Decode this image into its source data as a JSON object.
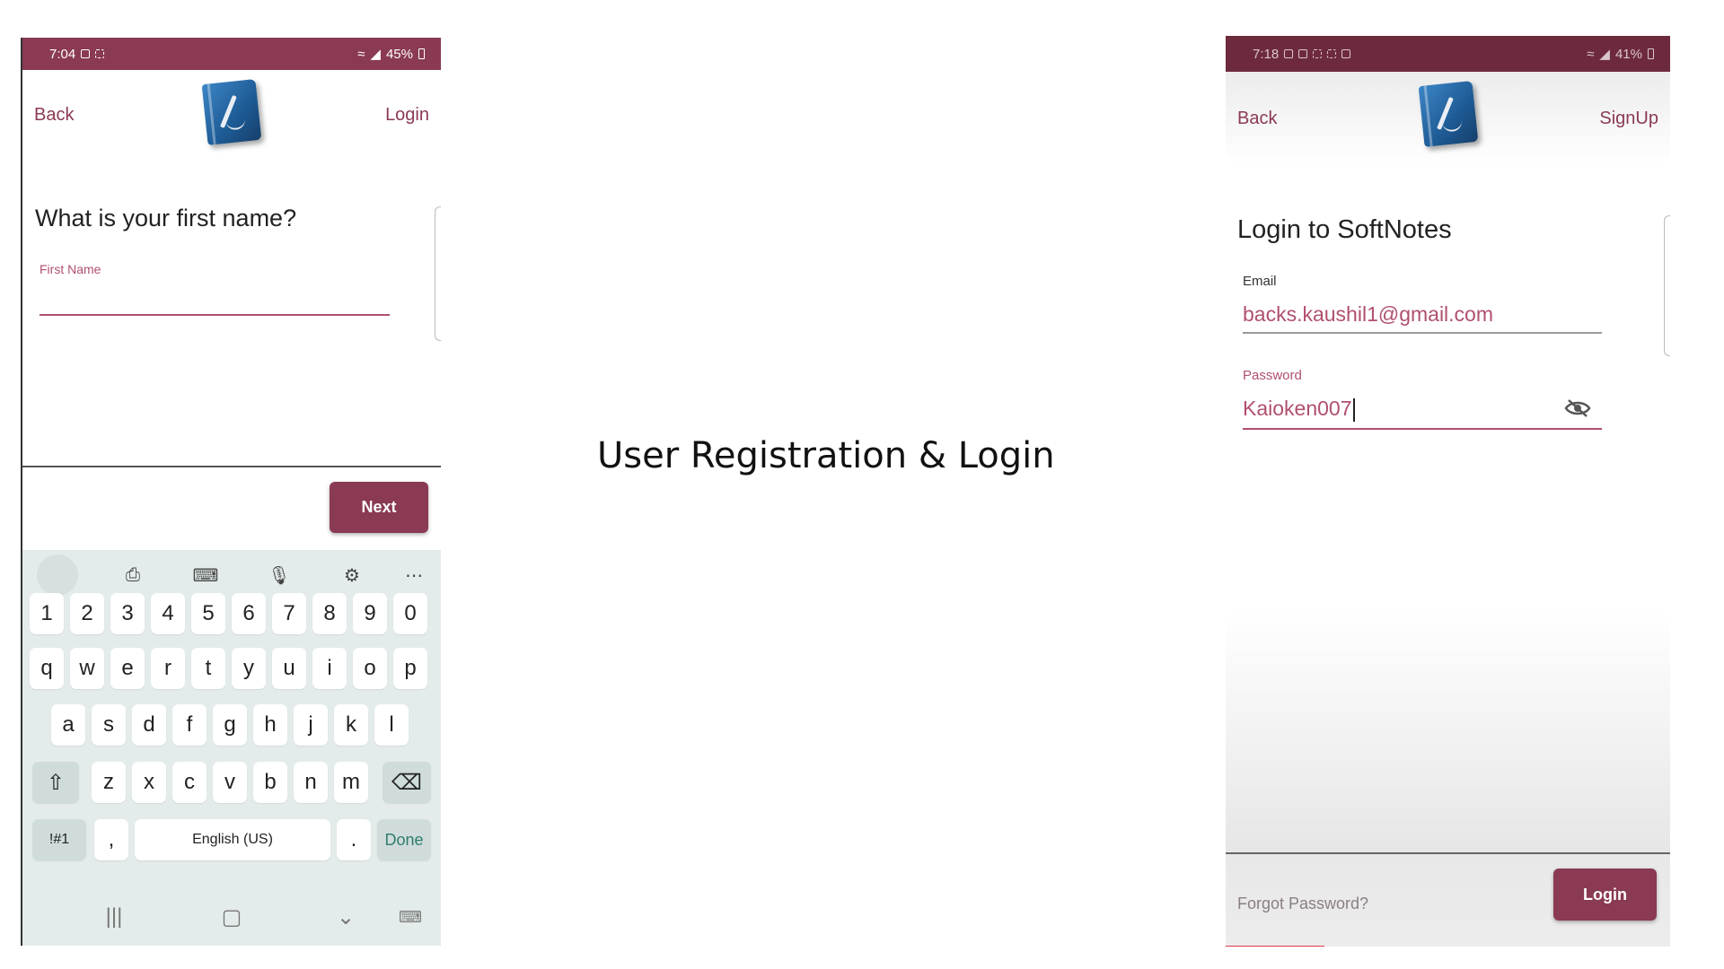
{
  "caption": "User Registration & Login",
  "left_phone": {
    "status": {
      "time": "7:04",
      "battery": "45%"
    },
    "appbar": {
      "back": "Back",
      "action": "Login"
    },
    "question": "What is your first name?",
    "field": {
      "label": "First Name",
      "value": ""
    },
    "next_button": "Next",
    "keyboard": {
      "toolbar_icons": [
        "clipboard-icon",
        "keyboard-layout-icon",
        "microphone-icon",
        "settings-icon",
        "more-icon"
      ],
      "row_numbers": [
        "1",
        "2",
        "3",
        "4",
        "5",
        "6",
        "7",
        "8",
        "9",
        "0"
      ],
      "row1": [
        "q",
        "w",
        "e",
        "r",
        "t",
        "y",
        "u",
        "i",
        "o",
        "p"
      ],
      "row2": [
        "a",
        "s",
        "d",
        "f",
        "g",
        "h",
        "j",
        "k",
        "l"
      ],
      "row3": [
        "z",
        "x",
        "c",
        "v",
        "b",
        "n",
        "m"
      ],
      "symbols": "!#1",
      "comma": ",",
      "space": "English (US)",
      "period": ".",
      "done": "Done"
    }
  },
  "right_phone": {
    "status": {
      "time": "7:18",
      "battery": "41%"
    },
    "appbar": {
      "back": "Back",
      "action": "SignUp"
    },
    "title": "Login to SoftNotes",
    "email": {
      "label": "Email",
      "value": "backs.kaushil1@gmail.com"
    },
    "password": {
      "label": "Password",
      "value": "Kaioken007"
    },
    "forgot": "Forgot Password?",
    "login_button": "Login"
  }
}
